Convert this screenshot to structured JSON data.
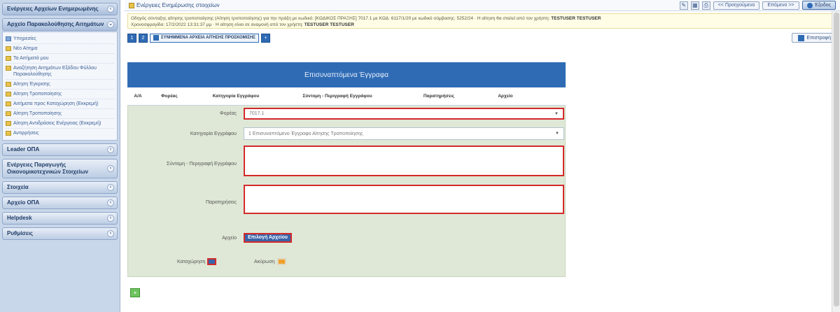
{
  "sidebar": {
    "sections": [
      {
        "label": "Ενέργειες Αρχείων Ενημερωμένης",
        "active": true
      },
      {
        "label": "Αρχείο Παρακολούθησης Αιτημάτων",
        "active": true
      }
    ],
    "submenu": [
      {
        "label": "Υπηρεσίες",
        "icon": "folder-icon"
      },
      {
        "label": "Νέο Αίτημα",
        "icon": "folder-icon"
      },
      {
        "label": "Τα Αιτήματά μου",
        "icon": "folder-icon"
      },
      {
        "label": "Αναζήτηση Αιτημάτων Εξόδου Φύλλου Παρακολούθησης",
        "icon": "folder-icon"
      },
      {
        "label": "Αίτηση Έγκρισης",
        "icon": "folder-icon"
      },
      {
        "label": "Αίτηση Τροποποίησης",
        "icon": "folder-icon"
      },
      {
        "label": "Αιτήματα προς Καταχώρηση (Εκκρεμή)",
        "icon": "folder-icon"
      },
      {
        "label": "Αίτηση Τροποποίησης",
        "icon": "folder-icon"
      },
      {
        "label": "Αίτηση Αντιδράσεις Ενέργειας (Εκκρεμή)",
        "icon": "folder-icon"
      },
      {
        "label": "Αντιρρήσεις",
        "icon": "folder-icon"
      }
    ],
    "lower_sections": [
      {
        "label": "Leader ΟΠΑ"
      },
      {
        "label": "Ενέργειες Παραγωγής Οικονομικοτεχνικών Στοιχείων"
      },
      {
        "label": "Στοιχεία"
      },
      {
        "label": "Αρχείο ΟΠΑ"
      },
      {
        "label": "Helpdesk"
      },
      {
        "label": "Ρυθμίσεις"
      }
    ]
  },
  "topbar": {
    "breadcrumb": "Ενέργειες Ενημέρωσης στοιχείων",
    "prev_label": "<< Προηγούμενο",
    "next_label": "Επόμενο >>",
    "exit_label": "Έξοδος"
  },
  "info": {
    "line1": "Οδηγός σύνταξης αίτησης τροποποίησης (Αίτηση τροποποίησης) για την πράξη με κωδικό: [ΚΩΔΙΚΟΣ ΠΡΑΞΗΣ] 7017.1 με ΚΩΔ: 6117/1/20 με κωδικό σύμβασης: 5252/24 · Η αίτηση θα σταλεί από τον χρήστη:",
    "user1": "TESTUSER TESTUSER",
    "line2": "Χρονοσφραγίδα: 17/2/2022 13:31:37 μμ · Η αίτηση είναι σε αναμονή από τον χρήστη:",
    "user2": "TESTUSER TESTUSER"
  },
  "toolbar": {
    "step_label": "ΣΥΝΗΜΜΕΝΑ ΑΡΧΕΙΑ ΑΙΤΗΣΗΣ ΠΡΟΣΚΟΜΙΣΗΣ",
    "back_label": "Επιστροφή"
  },
  "panel": {
    "title": "Επισυναπτόμενα Έγγραφα",
    "columns": [
      "Α/Α",
      "Φορέας",
      "Κατηγορία Εγγράφου",
      "Σύντομη - Περιγραφή Εγγράφου",
      "Παρατηρήσεις",
      "Αρχείο"
    ]
  },
  "form": {
    "foreas_label": "Φορέας",
    "foreas_value": "7017.1",
    "category_label": "Κατηγορία Εγγράφου",
    "category_value": "1 Επισυναπτόμενο Έγγραφο Αίτησης Τροποποίησης",
    "description_label": "Σύντομη - Περιγραφή Εγγράφου",
    "description_value": "",
    "notes_label": "Παρατηρήσεις",
    "notes_value": "",
    "file_label": "Αρχείο",
    "attach_button": "Επιλογή Αρχείου",
    "save_label": "Καταχώρηση",
    "cancel_label": "Ακύρωση"
  },
  "colors": {
    "accent": "#2f6bb5",
    "form_bg": "#dfe8d6",
    "highlight": "#d42a2a",
    "sidebar_bg": "#c9d7ea"
  }
}
